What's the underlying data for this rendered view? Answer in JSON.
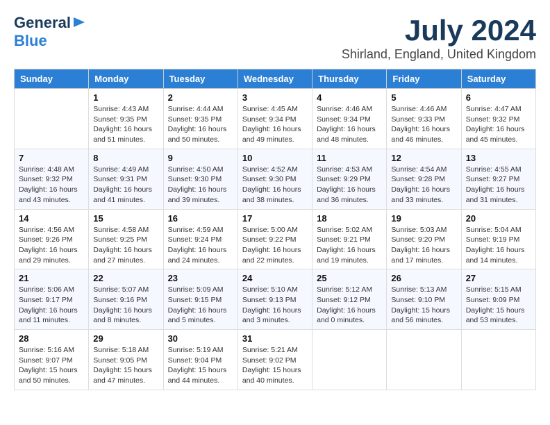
{
  "header": {
    "logo_line1": "General",
    "logo_line2": "Blue",
    "title": "July 2024",
    "subtitle": "Shirland, England, United Kingdom"
  },
  "days_of_week": [
    "Sunday",
    "Monday",
    "Tuesday",
    "Wednesday",
    "Thursday",
    "Friday",
    "Saturday"
  ],
  "weeks": [
    [
      {
        "day": "",
        "info": ""
      },
      {
        "day": "1",
        "info": "Sunrise: 4:43 AM\nSunset: 9:35 PM\nDaylight: 16 hours\nand 51 minutes."
      },
      {
        "day": "2",
        "info": "Sunrise: 4:44 AM\nSunset: 9:35 PM\nDaylight: 16 hours\nand 50 minutes."
      },
      {
        "day": "3",
        "info": "Sunrise: 4:45 AM\nSunset: 9:34 PM\nDaylight: 16 hours\nand 49 minutes."
      },
      {
        "day": "4",
        "info": "Sunrise: 4:46 AM\nSunset: 9:34 PM\nDaylight: 16 hours\nand 48 minutes."
      },
      {
        "day": "5",
        "info": "Sunrise: 4:46 AM\nSunset: 9:33 PM\nDaylight: 16 hours\nand 46 minutes."
      },
      {
        "day": "6",
        "info": "Sunrise: 4:47 AM\nSunset: 9:32 PM\nDaylight: 16 hours\nand 45 minutes."
      }
    ],
    [
      {
        "day": "7",
        "info": "Sunrise: 4:48 AM\nSunset: 9:32 PM\nDaylight: 16 hours\nand 43 minutes."
      },
      {
        "day": "8",
        "info": "Sunrise: 4:49 AM\nSunset: 9:31 PM\nDaylight: 16 hours\nand 41 minutes."
      },
      {
        "day": "9",
        "info": "Sunrise: 4:50 AM\nSunset: 9:30 PM\nDaylight: 16 hours\nand 39 minutes."
      },
      {
        "day": "10",
        "info": "Sunrise: 4:52 AM\nSunset: 9:30 PM\nDaylight: 16 hours\nand 38 minutes."
      },
      {
        "day": "11",
        "info": "Sunrise: 4:53 AM\nSunset: 9:29 PM\nDaylight: 16 hours\nand 36 minutes."
      },
      {
        "day": "12",
        "info": "Sunrise: 4:54 AM\nSunset: 9:28 PM\nDaylight: 16 hours\nand 33 minutes."
      },
      {
        "day": "13",
        "info": "Sunrise: 4:55 AM\nSunset: 9:27 PM\nDaylight: 16 hours\nand 31 minutes."
      }
    ],
    [
      {
        "day": "14",
        "info": "Sunrise: 4:56 AM\nSunset: 9:26 PM\nDaylight: 16 hours\nand 29 minutes."
      },
      {
        "day": "15",
        "info": "Sunrise: 4:58 AM\nSunset: 9:25 PM\nDaylight: 16 hours\nand 27 minutes."
      },
      {
        "day": "16",
        "info": "Sunrise: 4:59 AM\nSunset: 9:24 PM\nDaylight: 16 hours\nand 24 minutes."
      },
      {
        "day": "17",
        "info": "Sunrise: 5:00 AM\nSunset: 9:22 PM\nDaylight: 16 hours\nand 22 minutes."
      },
      {
        "day": "18",
        "info": "Sunrise: 5:02 AM\nSunset: 9:21 PM\nDaylight: 16 hours\nand 19 minutes."
      },
      {
        "day": "19",
        "info": "Sunrise: 5:03 AM\nSunset: 9:20 PM\nDaylight: 16 hours\nand 17 minutes."
      },
      {
        "day": "20",
        "info": "Sunrise: 5:04 AM\nSunset: 9:19 PM\nDaylight: 16 hours\nand 14 minutes."
      }
    ],
    [
      {
        "day": "21",
        "info": "Sunrise: 5:06 AM\nSunset: 9:17 PM\nDaylight: 16 hours\nand 11 minutes."
      },
      {
        "day": "22",
        "info": "Sunrise: 5:07 AM\nSunset: 9:16 PM\nDaylight: 16 hours\nand 8 minutes."
      },
      {
        "day": "23",
        "info": "Sunrise: 5:09 AM\nSunset: 9:15 PM\nDaylight: 16 hours\nand 5 minutes."
      },
      {
        "day": "24",
        "info": "Sunrise: 5:10 AM\nSunset: 9:13 PM\nDaylight: 16 hours\nand 3 minutes."
      },
      {
        "day": "25",
        "info": "Sunrise: 5:12 AM\nSunset: 9:12 PM\nDaylight: 16 hours\nand 0 minutes."
      },
      {
        "day": "26",
        "info": "Sunrise: 5:13 AM\nSunset: 9:10 PM\nDaylight: 15 hours\nand 56 minutes."
      },
      {
        "day": "27",
        "info": "Sunrise: 5:15 AM\nSunset: 9:09 PM\nDaylight: 15 hours\nand 53 minutes."
      }
    ],
    [
      {
        "day": "28",
        "info": "Sunrise: 5:16 AM\nSunset: 9:07 PM\nDaylight: 15 hours\nand 50 minutes."
      },
      {
        "day": "29",
        "info": "Sunrise: 5:18 AM\nSunset: 9:05 PM\nDaylight: 15 hours\nand 47 minutes."
      },
      {
        "day": "30",
        "info": "Sunrise: 5:19 AM\nSunset: 9:04 PM\nDaylight: 15 hours\nand 44 minutes."
      },
      {
        "day": "31",
        "info": "Sunrise: 5:21 AM\nSunset: 9:02 PM\nDaylight: 15 hours\nand 40 minutes."
      },
      {
        "day": "",
        "info": ""
      },
      {
        "day": "",
        "info": ""
      },
      {
        "day": "",
        "info": ""
      }
    ]
  ]
}
